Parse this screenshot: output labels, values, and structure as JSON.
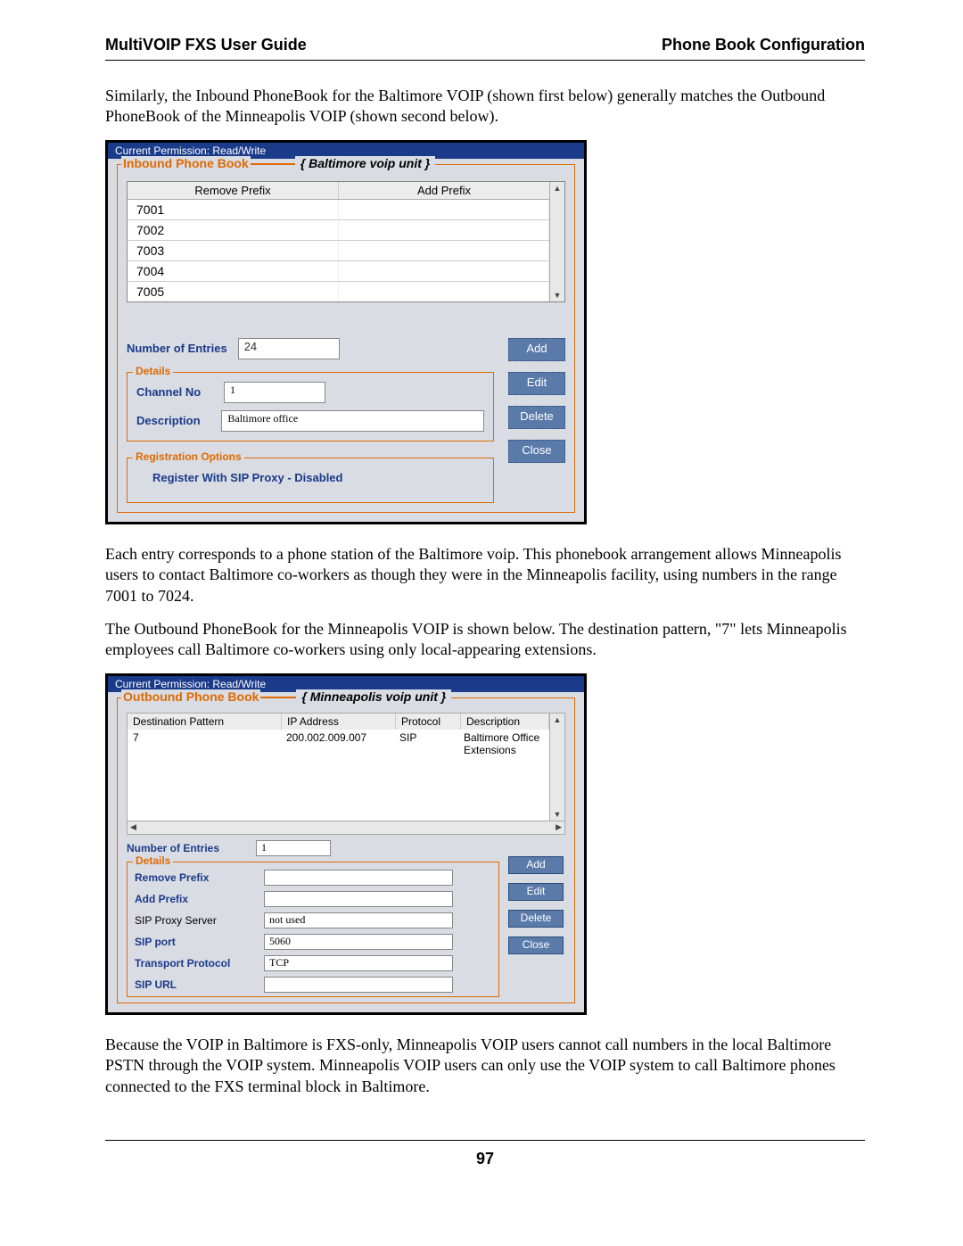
{
  "header": {
    "left": "MultiVOIP FXS User Guide",
    "right": "Phone Book Configuration"
  },
  "paragraphs": {
    "p1": "Similarly, the Inbound PhoneBook for the Baltimore VOIP (shown first below) generally matches the Outbound PhoneBook of the Minneapolis VOIP (shown second below).",
    "p2": "Each entry corresponds to a phone station of the Baltimore voip. This phonebook arrangement allows Minneapolis users to contact Baltimore co-workers as though they were in the Minneapolis facility, using numbers in the range 7001 to 7024.",
    "p3": "The Outbound PhoneBook for the Minneapolis VOIP is shown below.  The destination pattern, \"7\" lets Minneapolis employees call Baltimore co-workers using only local-appearing extensions.",
    "p4": "Because the VOIP in Baltimore is FXS-only, Minneapolis VOIP users cannot call numbers in the local Baltimore PSTN through the VOIP system.  Minneapolis VOIP users can only use the VOIP system to call Baltimore phones connected to the FXS terminal block in Baltimore."
  },
  "inbound": {
    "permission": "Current Permission:  Read/Write",
    "group_label": "Inbound Phone Book",
    "unit_label": "{ Baltimore voip unit }",
    "headers": {
      "remove": "Remove Prefix",
      "add": "Add Prefix"
    },
    "rows": [
      "7001",
      "7002",
      "7003",
      "7004",
      "7005"
    ],
    "entries_label": "Number of Entries",
    "entries_value": "24",
    "details": {
      "title": "Details",
      "channel_label": "Channel No",
      "channel_value": "1",
      "desc_label": "Description",
      "desc_value": "Baltimore office"
    },
    "reg": {
      "title": "Registration Options",
      "text": "Register With SIP Proxy  - Disabled"
    },
    "buttons": {
      "add": "Add",
      "edit": "Edit",
      "delete": "Delete",
      "close": "Close"
    }
  },
  "outbound": {
    "permission": "Current Permission:  Read/Write",
    "group_label": "Outbound Phone Book",
    "unit_label": "{ Minneapolis voip unit }",
    "headers": {
      "dest": "Destination Pattern",
      "ip": "IP Address",
      "proto": "Protocol",
      "desc": "Description"
    },
    "row": {
      "dest": "7",
      "ip": "200.002.009.007",
      "proto": "SIP",
      "desc": "Baltimore Office Extensions"
    },
    "entries_label": "Number of Entries",
    "entries_value": "1",
    "details": {
      "title": "Details",
      "remove_label": "Remove Prefix",
      "remove_value": "",
      "add_label": "Add Prefix",
      "add_value": "",
      "sipproxy_label": "SIP Proxy Server",
      "sipproxy_value": "not used",
      "sipport_label": "SIP port",
      "sipport_value": "5060",
      "transport_label": "Transport Protocol",
      "transport_value": "TCP",
      "url_label": "SIP URL",
      "url_value": ""
    },
    "buttons": {
      "add": "Add",
      "edit": "Edit",
      "delete": "Delete",
      "close": "Close"
    }
  },
  "page_number": "97"
}
